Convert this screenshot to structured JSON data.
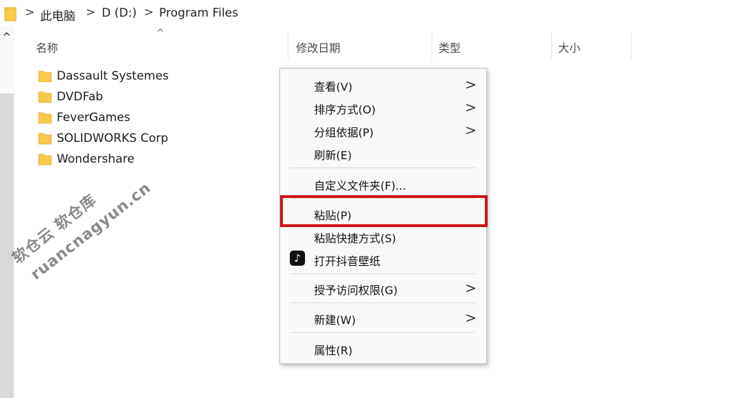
{
  "address": {
    "crumbs": [
      "此电脑",
      "D (D:)",
      "Program Files"
    ],
    "separator": ">"
  },
  "columns": {
    "name": "名称",
    "modified": "修改日期",
    "type": "类型",
    "size": "大小",
    "sort_caret": "^"
  },
  "scroll": {
    "up_arrow": "^"
  },
  "files": [
    {
      "name": "Dassault Systemes"
    },
    {
      "name": "DVDFab"
    },
    {
      "name": "FeverGames"
    },
    {
      "name": "SOLIDWORKS Corp"
    },
    {
      "name": "Wondershare"
    }
  ],
  "context_menu": {
    "items": [
      {
        "label": "查看(V)",
        "submenu": true
      },
      {
        "label": "排序方式(O)",
        "submenu": true
      },
      {
        "label": "分组依据(P)",
        "submenu": true
      },
      {
        "label": "刷新(E)",
        "submenu": false
      },
      {
        "label": "自定义文件夹(F)...",
        "submenu": false
      },
      {
        "label": "粘贴(P)",
        "submenu": false,
        "highlighted": true
      },
      {
        "label": "粘贴快捷方式(S)",
        "submenu": false
      },
      {
        "label": "打开抖音壁纸",
        "submenu": false,
        "icon": "tiktok-icon"
      },
      {
        "label": "授予访问权限(G)",
        "submenu": true
      },
      {
        "label": "新建(W)",
        "submenu": true
      },
      {
        "label": "属性(R)",
        "submenu": false
      }
    ],
    "chevron": ">"
  },
  "watermark": {
    "line1": "软仓云 软仓库",
    "line2": "ruancnagyun.cn"
  },
  "colors": {
    "highlight_border": "#d0121c",
    "folder_yellow": "#f8c94a",
    "menu_bg": "#f9f9f9"
  }
}
